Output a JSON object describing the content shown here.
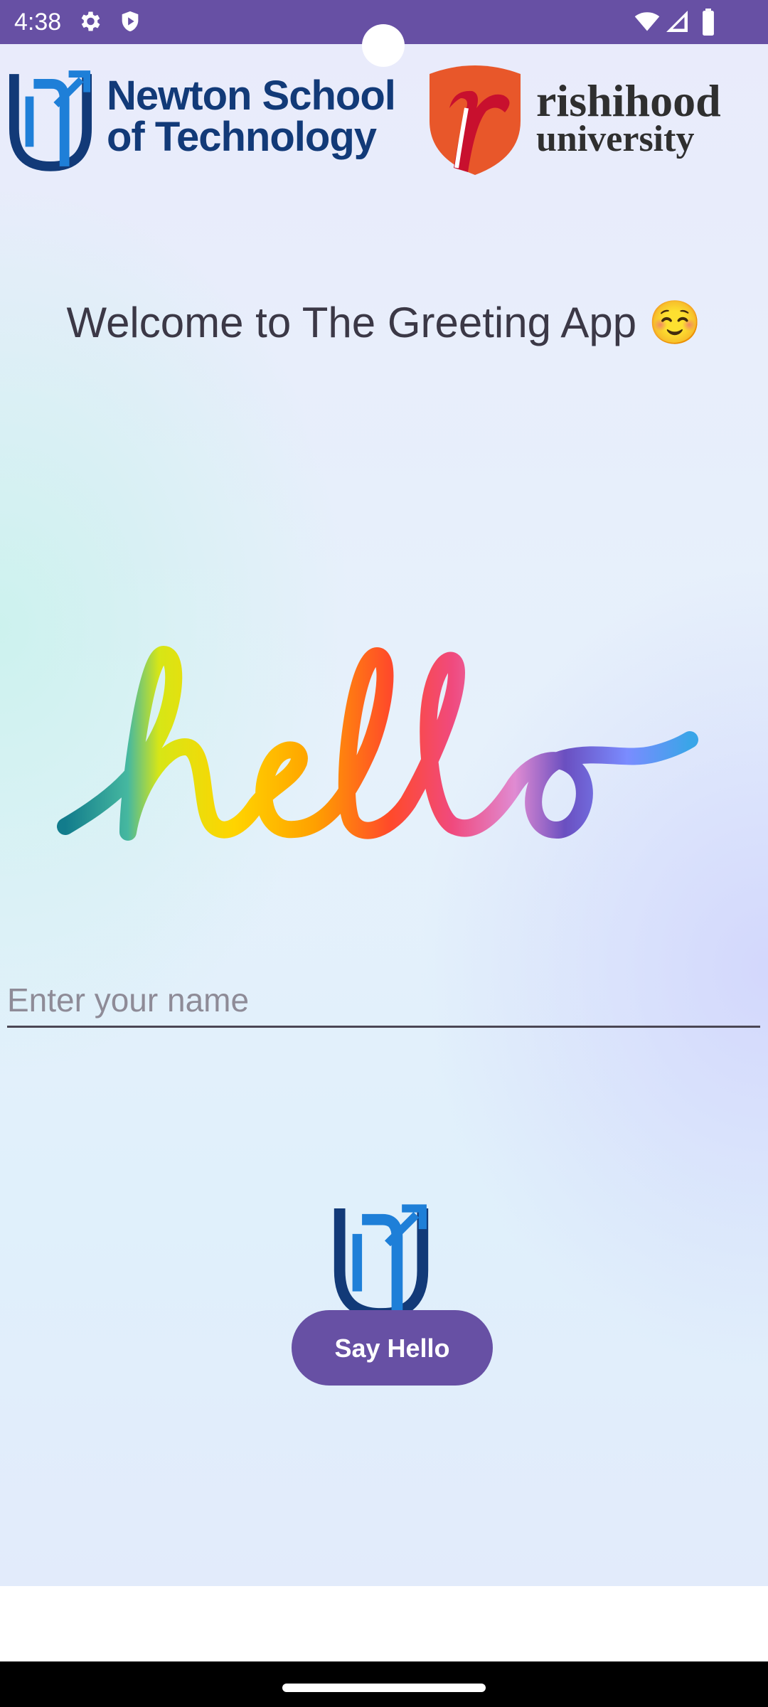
{
  "status_bar": {
    "time": "4:38",
    "left_icons": [
      "gear-icon",
      "shield-icon"
    ],
    "right_icons": [
      "wifi-icon",
      "signal-icon",
      "battery-icon"
    ],
    "color": "#6750a4"
  },
  "header": {
    "newton_logo": {
      "line1": "Newton School",
      "line2": "of Technology"
    },
    "rishihood_logo": {
      "line1": "rishihood",
      "line2": "university"
    }
  },
  "main": {
    "welcome_text": "Welcome to The Greeting App ☺️",
    "hello_image_text": "hello",
    "name_input": {
      "placeholder": "Enter your name",
      "value": ""
    },
    "say_hello_button": "Say Hello"
  },
  "colors": {
    "accent": "#6750a4",
    "newton_navy": "#123a78",
    "newton_blue": "#1e7fd8",
    "rishihood_orange": "#e8572a",
    "rishihood_red": "#c8102e"
  }
}
